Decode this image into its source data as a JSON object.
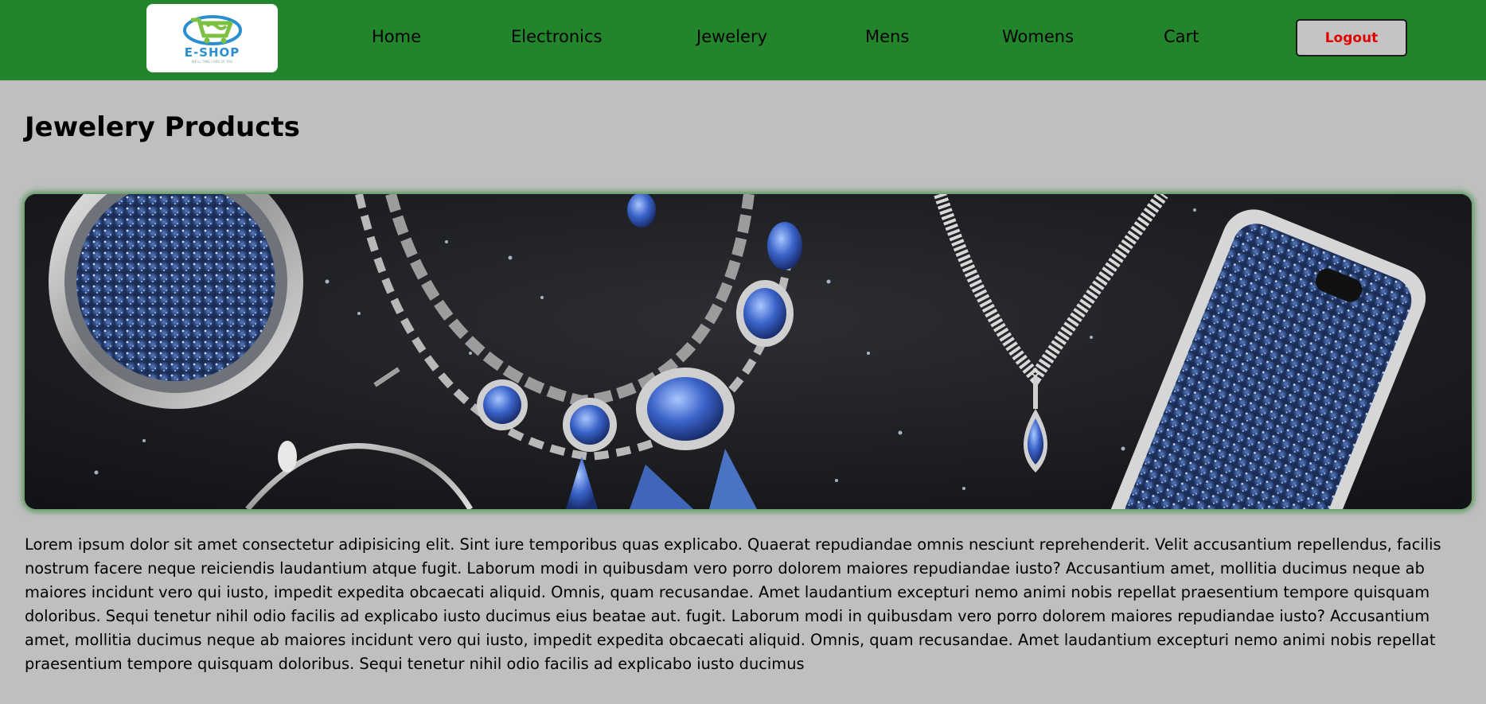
{
  "header": {
    "logo": {
      "text": "E-SHOP",
      "tagline": "WE'LL TAKE CARE OF YOU"
    },
    "nav": [
      {
        "label": "Home"
      },
      {
        "label": "Electronics"
      },
      {
        "label": "Jewelery"
      },
      {
        "label": "Mens"
      },
      {
        "label": "Womens"
      },
      {
        "label": "Cart"
      }
    ],
    "logout_label": "Logout"
  },
  "main": {
    "title": "Jewelery Products",
    "description": "Lorem ipsum dolor sit amet consectetur adipisicing elit. Sint iure temporibus quas explicabo. Quaerat repudiandae omnis nesciunt reprehenderit. Velit accusantium repellendus, facilis nostrum facere neque reiciendis laudantium atque fugit. Laborum modi in quibusdam vero porro dolorem maiores repudiandae iusto? Accusantium amet, mollitia ducimus neque ab maiores incidunt vero qui iusto, impedit expedita obcaecati aliquid. Omnis, quam recusandae. Amet laudantium excepturi nemo animi nobis repellat praesentium tempore quisquam doloribus. Sequi tenetur nihil odio facilis ad explicabo iusto ducimus eius beatae aut. fugit. Laborum modi in quibusdam vero porro dolorem maiores repudiandae iusto? Accusantium amet, mollitia ducimus neque ab maiores incidunt vero qui iusto, impedit expedita obcaecati aliquid. Omnis, quam recusandae. Amet laudantium excepturi nemo animi nobis repellat praesentium tempore quisquam doloribus. Sequi tenetur nihil odio facilis ad explicabo iusto ducimus"
  },
  "colors": {
    "navbar": "#23852b",
    "page_background": "#bfbfbf",
    "logout_text": "#e00000",
    "logo_green": "#7cc142",
    "logo_blue": "#2b8fcf"
  },
  "icons": {
    "logo": "shopping-cart-logo-icon"
  }
}
